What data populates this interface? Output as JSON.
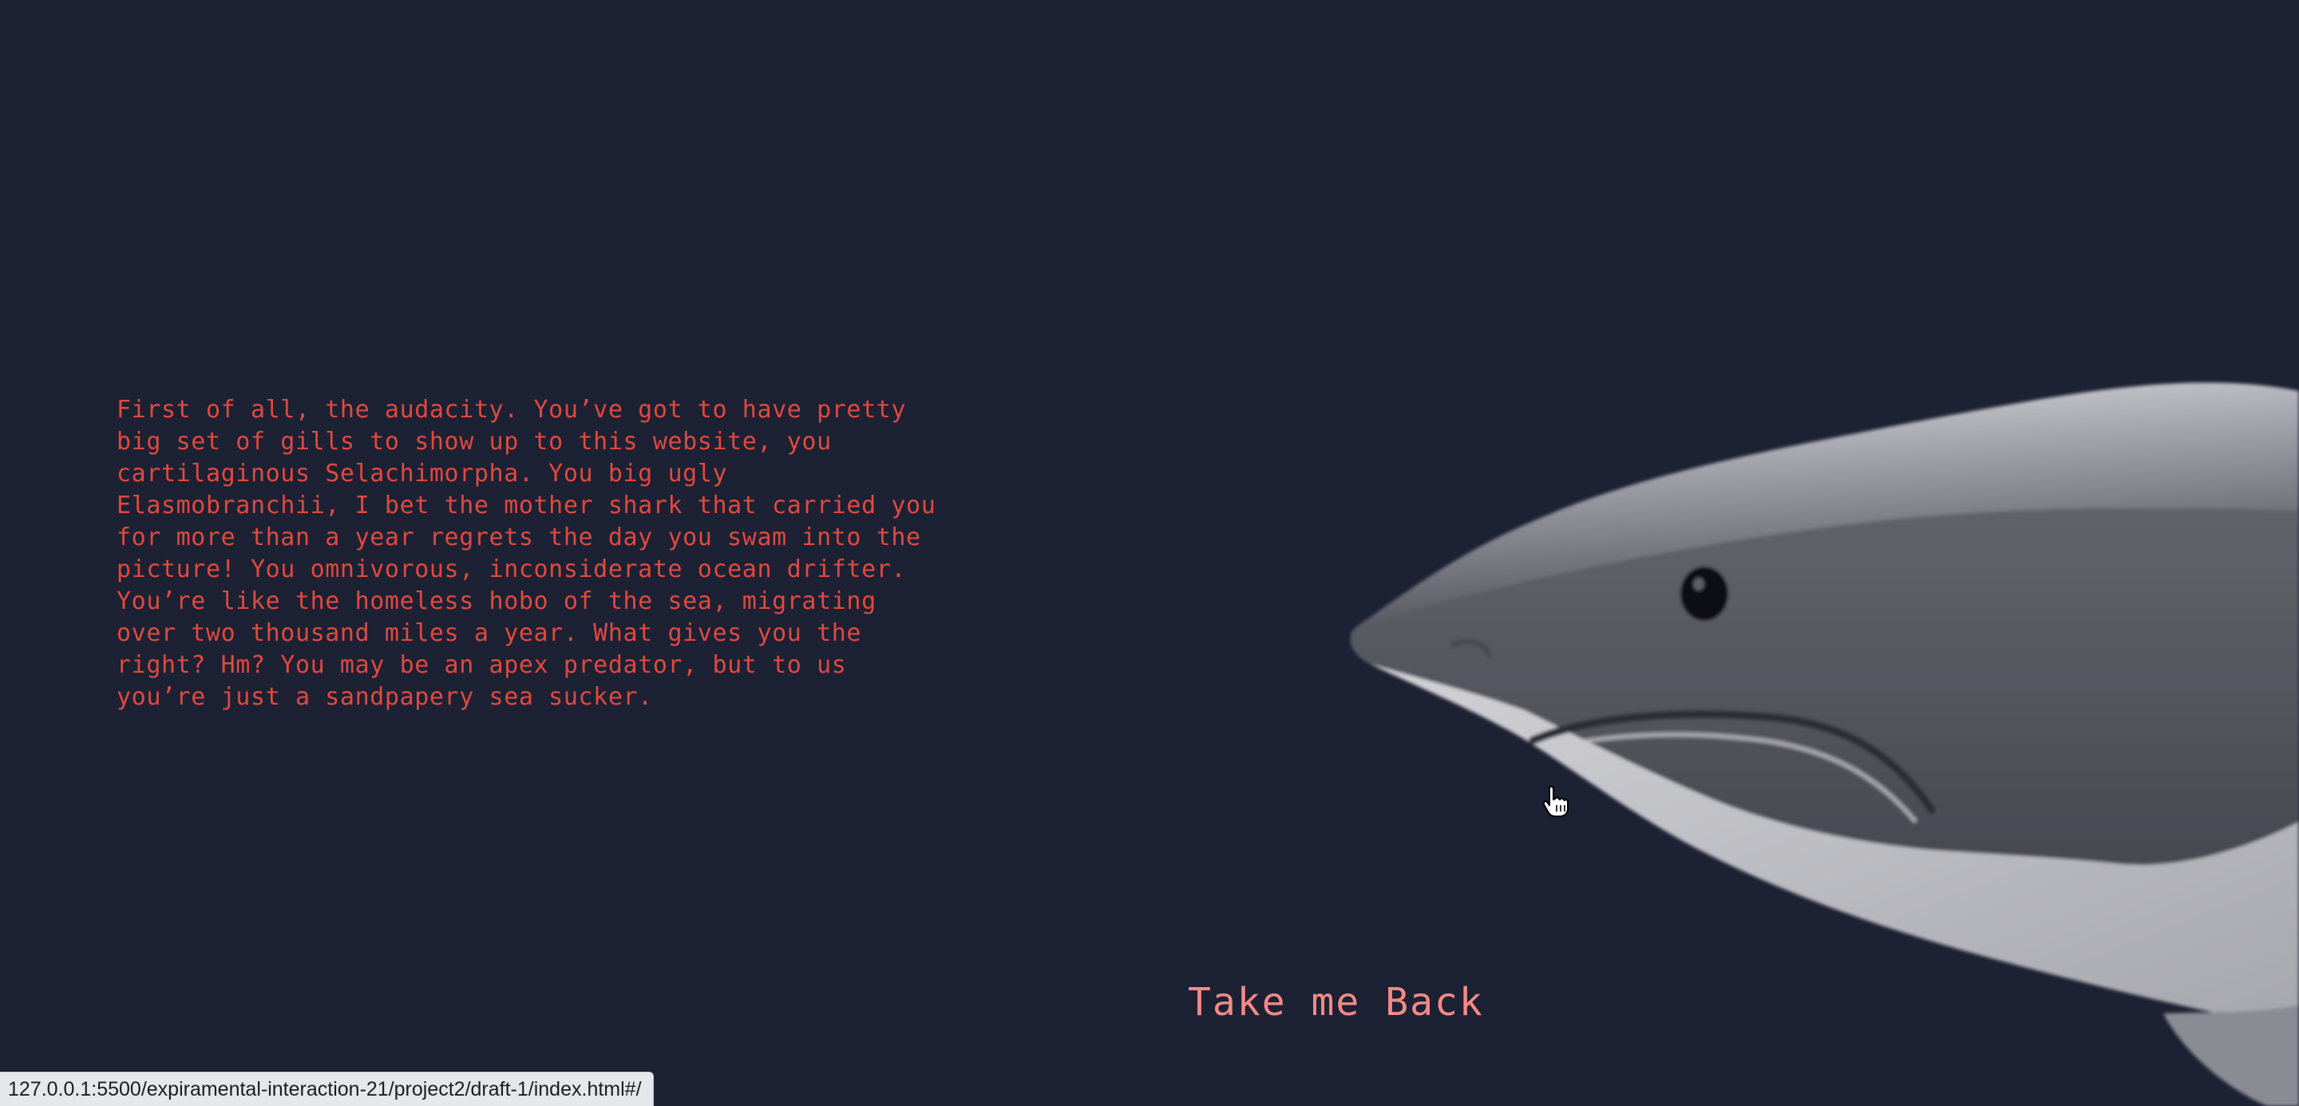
{
  "page": {
    "background_color": "#1d2134",
    "text_color": "#e0493e",
    "link_color": "#f58a86"
  },
  "insult": {
    "text": "First of all, the audacity. You’ve got to have pretty\nbig set of gills to show up to this website, you\ncartilaginous Selachimorpha. You big ugly\nElasmobranchii, I bet the mother shark that carried you\nfor more than a year regrets the day you swam into the\npicture! You omnivorous, inconsiderate ocean drifter.\nYou’re like the homeless hobo of the sea, migrating\nover two thousand miles a year. What gives you the\nright? Hm? You may be an apex predator, but to us\nyou’re just a sandpapery sea sucker."
  },
  "image": {
    "subject": "great white shark head, grayscale photo"
  },
  "back_link": {
    "label": "Take me Back"
  },
  "cursor": {
    "type": "pointer-hand-icon"
  },
  "status_bar": {
    "url": "127.0.0.1:5500/expiramental-interaction-21/project2/draft-1/index.html#/"
  }
}
